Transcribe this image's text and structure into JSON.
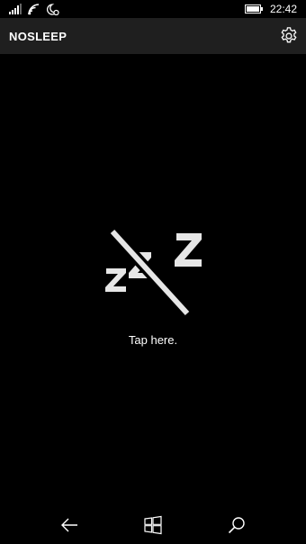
{
  "status_bar": {
    "time": "22:42",
    "icons": [
      "signal-bars-icon",
      "wifi-icon",
      "quiet-hours-icon",
      "battery-icon"
    ]
  },
  "app_bar": {
    "title": "NOSLEEP",
    "settings_icon": "gear-icon"
  },
  "main": {
    "toggle_icon": "zzz-crossed-icon",
    "tap_label": "Tap here."
  },
  "nav_bar": {
    "icons": [
      "back-arrow-icon",
      "windows-start-icon",
      "search-icon"
    ]
  },
  "colors": {
    "background": "#000000",
    "app_bar": "#1f1f1f",
    "icon": "#e6e6e6",
    "text": "#ffffff"
  }
}
